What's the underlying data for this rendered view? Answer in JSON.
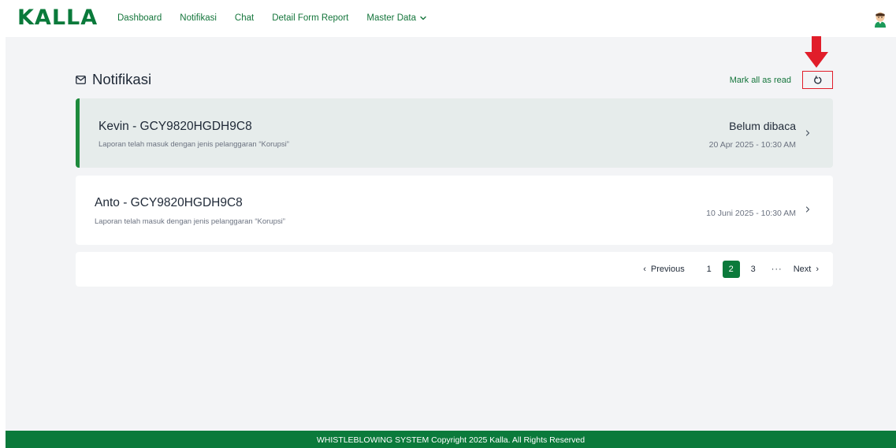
{
  "brand": {
    "logo_text": "KALLA",
    "accent_color": "#0b7a3b"
  },
  "nav": {
    "items": [
      {
        "label": "Dashboard"
      },
      {
        "label": "Notifikasi"
      },
      {
        "label": "Chat"
      },
      {
        "label": "Detail Form Report"
      },
      {
        "label": "Master Data",
        "icon": "chevron-down-icon"
      }
    ],
    "avatar_icon": "user-avatar-icon"
  },
  "header": {
    "icon": "mail-icon",
    "title": "Notifikasi",
    "mark_all_read": "Mark all as read",
    "refresh_icon": "refresh-icon",
    "highlight_color": "#e11d2a"
  },
  "notifications": [
    {
      "title": "Kevin - GCY9820HGDH9C8",
      "subtitle": "Laporan telah masuk dengan jenis pelanggaran “Korupsi”",
      "status": "Belum dibaca",
      "time": "20 Apr 2025 - 10:30 AM",
      "unread": true
    },
    {
      "title": "Anto - GCY9820HGDH9C8",
      "subtitle": "Laporan telah masuk dengan jenis pelanggaran “Korupsi”",
      "status": "",
      "time": "10 Juni 2025 - 10:30 AM",
      "unread": false
    }
  ],
  "pagination": {
    "previous": "Previous",
    "pages": [
      "1",
      "2",
      "3"
    ],
    "active_page": "2",
    "ellipsis": "···",
    "next": "Next",
    "prev_arrow": "‹",
    "next_arrow": "›"
  },
  "footer": {
    "text": "WHISTLEBLOWING SYSTEM Copyright 2025 Kalla. All Rights Reserved"
  }
}
